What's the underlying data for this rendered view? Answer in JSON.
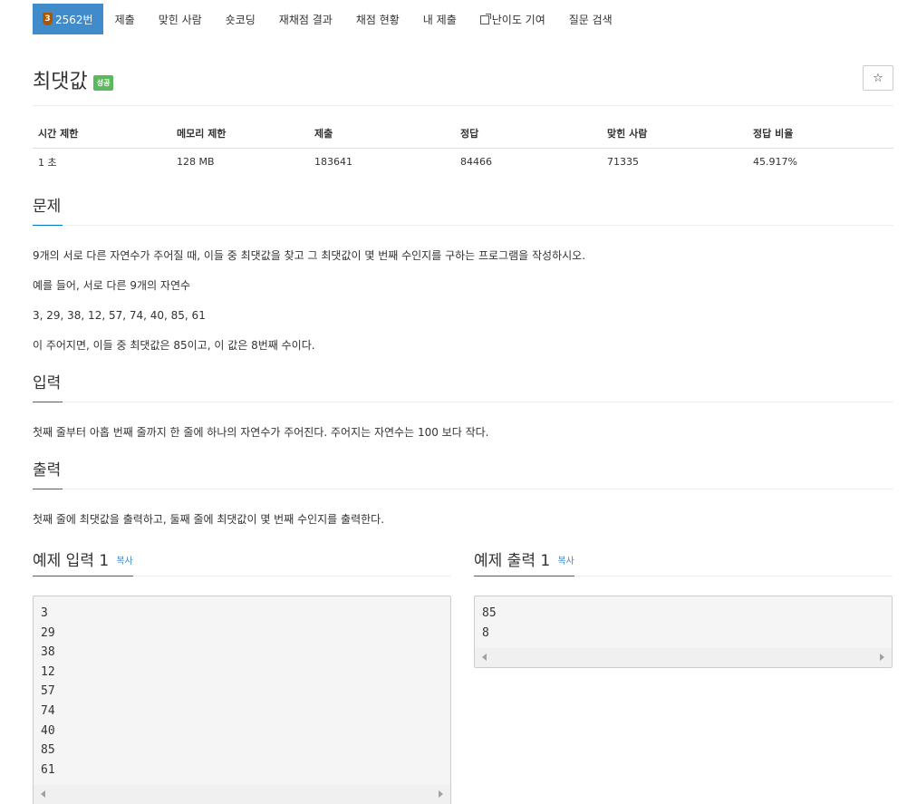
{
  "nav": {
    "tier": "3",
    "items": [
      {
        "label": "2562번"
      },
      {
        "label": "제출"
      },
      {
        "label": "맞힌 사람"
      },
      {
        "label": "숏코딩"
      },
      {
        "label": "재채점 결과"
      },
      {
        "label": "채점 현황"
      },
      {
        "label": "내 제출"
      },
      {
        "label": "난이도 기여"
      },
      {
        "label": "질문 검색"
      }
    ]
  },
  "problem": {
    "title": "최댓값",
    "result_badge": "성공",
    "star_icon": "☆"
  },
  "info": {
    "headers": [
      "시간 제한",
      "메모리 제한",
      "제출",
      "정답",
      "맞힌 사람",
      "정답 비율"
    ],
    "values": [
      "1 초",
      "128 MB",
      "183641",
      "84466",
      "71335",
      "45.917%"
    ]
  },
  "description": {
    "heading": "문제",
    "p1": "9개의 서로 다른 자연수가 주어질 때, 이들 중 최댓값을 찾고 그 최댓값이 몇 번째 수인지를 구하는 프로그램을 작성하시오.",
    "p2": "예를 들어, 서로 다른 9개의 자연수",
    "p3": "3, 29, 38, 12, 57, 74, 40, 85, 61",
    "p4": "이 주어지면, 이들 중 최댓값은 85이고, 이 값은 8번째 수이다."
  },
  "input": {
    "heading": "입력",
    "text": "첫째 줄부터 아홉 번째 줄까지 한 줄에 하나의 자연수가 주어진다. 주어지는 자연수는 100 보다 작다."
  },
  "output": {
    "heading": "출력",
    "text": "첫째 줄에 최댓값을 출력하고, 둘째 줄에 최댓값이 몇 번째 수인지를 출력한다."
  },
  "sample_input": {
    "heading": "예제 입력 1",
    "copy": "복사",
    "content": "3\n29\n38\n12\n57\n74\n40\n85\n61"
  },
  "sample_output": {
    "heading": "예제 출력 1",
    "copy": "복사",
    "content": "85\n8"
  }
}
